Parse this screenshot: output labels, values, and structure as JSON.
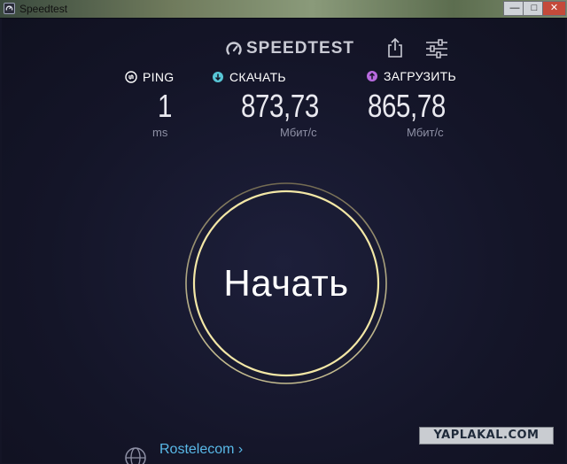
{
  "window": {
    "title": "Speedtest",
    "minimize_label": "—",
    "maximize_label": "□",
    "close_label": "✕"
  },
  "header": {
    "logo_text": "SPEEDTEST",
    "share_icon": "share-icon",
    "settings_icon": "settings-sliders-icon"
  },
  "metrics": {
    "ping": {
      "label": "PING",
      "value": "1",
      "unit": "ms",
      "icon": "ping-icon"
    },
    "download": {
      "label": "СКАЧАТЬ",
      "value": "873,73",
      "unit": "Мбит/с",
      "icon": "download-icon",
      "color": "#58c6d6"
    },
    "upload": {
      "label": "ЗАГРУЗИТЬ",
      "value": "865,78",
      "unit": "Мбит/с",
      "icon": "upload-icon",
      "color": "#b86adf"
    }
  },
  "start_button": {
    "label": "Начать",
    "ring_color": "#f3e7a6"
  },
  "provider": {
    "name": "Rostelecom ›",
    "icon": "globe-icon",
    "color": "#59b9e8"
  },
  "watermark": {
    "text": "YAPLAKAL.COM"
  }
}
